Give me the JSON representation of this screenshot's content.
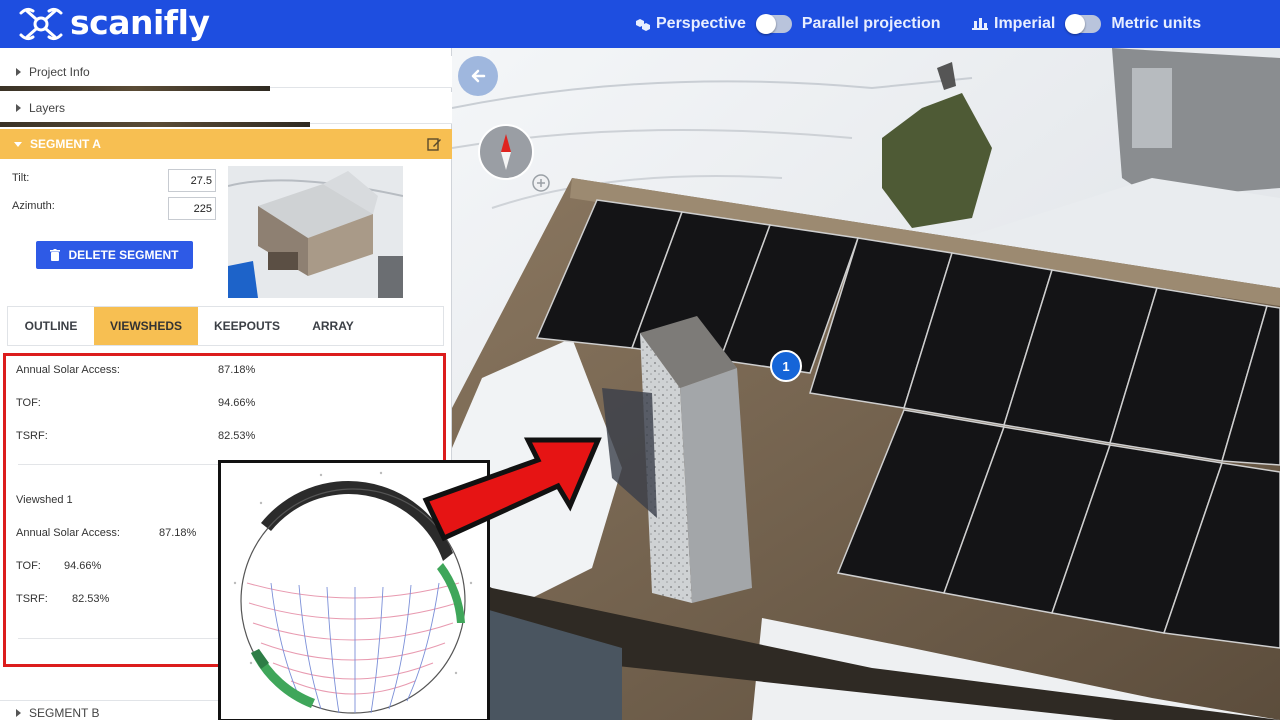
{
  "app": {
    "brand": "scanifly"
  },
  "topbar": {
    "perspective_label": "Perspective",
    "parallel_label": "Parallel projection",
    "imperial_label": "Imperial",
    "metric_label": "Metric units"
  },
  "panel": {
    "project_info_label": "Project Info",
    "layers_label": "Layers",
    "segment_a_label": "SEGMENT A",
    "segment_b_label": "SEGMENT B",
    "tilt_label": "Tilt:",
    "tilt_value": "27.5",
    "azimuth_label": "Azimuth:",
    "azimuth_value": "225",
    "delete_label": "DELETE SEGMENT",
    "tabs": [
      "OUTLINE",
      "VIEWSHEDS",
      "KEEPOUTS",
      "ARRAY"
    ],
    "active_tab": "VIEWSHEDS"
  },
  "viewshed_summary": {
    "annual_label": "Annual Solar Access:",
    "annual_value": "87.18%",
    "tof_label": "TOF:",
    "tof_value": "94.66%",
    "tsrf_label": "TSRF:",
    "tsrf_value": "82.53%"
  },
  "viewshed_1": {
    "title": "Viewshed 1",
    "annual_label": "Annual Solar Access:",
    "annual_value": "87.18%",
    "tof_label": "TOF:",
    "tof_value": "94.66%",
    "tsrf_label": "TSRF:",
    "tsrf_value": "82.53%"
  },
  "viewport": {
    "marker_label": "1"
  },
  "colors": {
    "topbar": "#1e4ee0",
    "accent_yellow": "#f7bf52",
    "delete_button": "#2e5ae6",
    "highlight_red": "#dc1c1c",
    "marker_blue": "#1565d8"
  },
  "icons": [
    "scanifly-logo-icon",
    "perspective-icon",
    "chart-bars-icon",
    "back-arrow-icon",
    "compass-icon",
    "edit-icon",
    "trash-icon",
    "plus-icon"
  ]
}
